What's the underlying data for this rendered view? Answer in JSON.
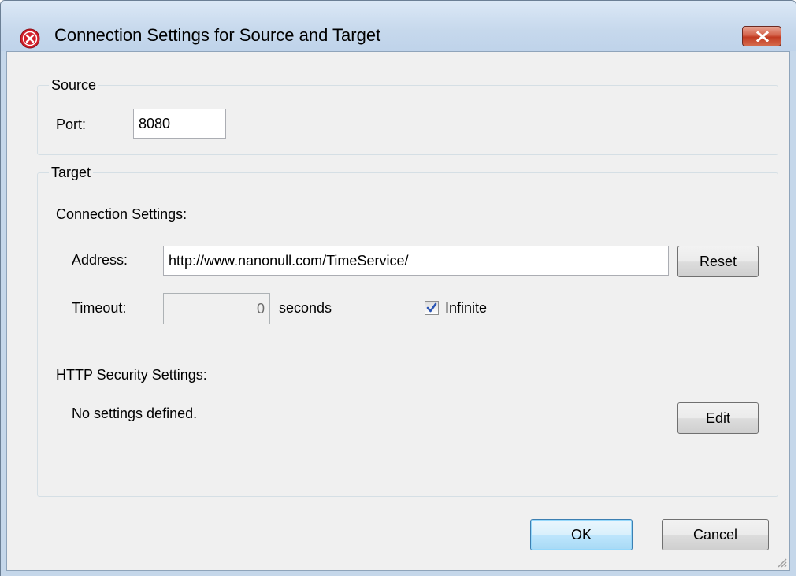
{
  "window": {
    "title": "Connection Settings for Source and Target",
    "icon": "altova-red-x-icon",
    "close_icon": "close-icon"
  },
  "source": {
    "group_label": "Source",
    "port_label": "Port:",
    "port_value": "8080"
  },
  "target": {
    "group_label": "Target",
    "connection_settings_label": "Connection Settings:",
    "address_label": "Address:",
    "address_value": "http://www.nanonull.com/TimeService/",
    "reset_label": "Reset",
    "timeout_label": "Timeout:",
    "timeout_value": "0",
    "seconds_label": "seconds",
    "infinite_label": "Infinite",
    "infinite_checked": true,
    "http_security_label": "HTTP Security Settings:",
    "http_security_status": "No settings defined.",
    "edit_label": "Edit"
  },
  "footer": {
    "ok_label": "OK",
    "cancel_label": "Cancel"
  },
  "colors": {
    "titlebar": "#c6d8ec",
    "close_button": "#c13b22",
    "dialog_background": "#f0f0f0",
    "default_button_border": "#3c7fb1"
  }
}
